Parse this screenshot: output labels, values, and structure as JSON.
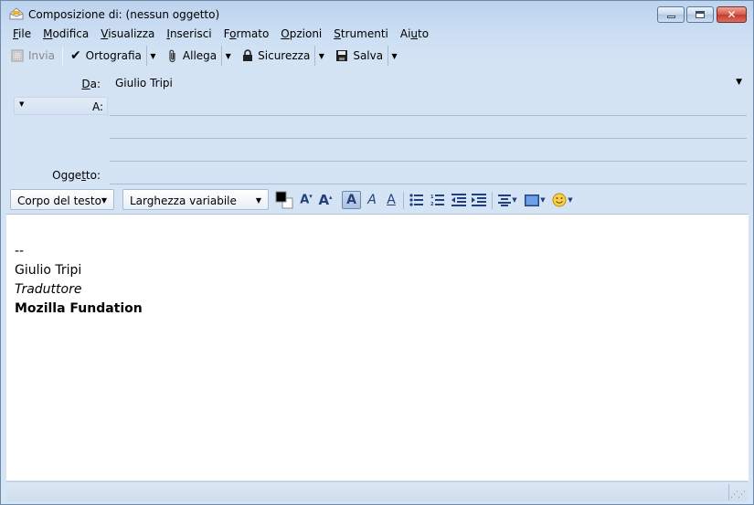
{
  "window": {
    "title": "Composizione di: (nessun oggetto)"
  },
  "menu": [
    {
      "pre": "",
      "acc": "F",
      "post": "ile"
    },
    {
      "pre": "",
      "acc": "M",
      "post": "odifica"
    },
    {
      "pre": "",
      "acc": "V",
      "post": "isualizza"
    },
    {
      "pre": "",
      "acc": "I",
      "post": "nserisci"
    },
    {
      "pre": "F",
      "acc": "o",
      "post": "rmato"
    },
    {
      "pre": "",
      "acc": "O",
      "post": "pzioni"
    },
    {
      "pre": "",
      "acc": "S",
      "post": "trumenti"
    },
    {
      "pre": "Ai",
      "acc": "u",
      "post": "to"
    }
  ],
  "toolbar": {
    "send_label": "Invia",
    "spelling_label": "Ortografia",
    "attach_label": "Allega",
    "security_label": "Sicurezza",
    "save_label": "Salva"
  },
  "header": {
    "from_label_acc": "D",
    "from_label_rest": "a:",
    "from_value": "Giulio Tripi",
    "to_label": "A:",
    "subject_label_pre": "Ogge",
    "subject_label_acc": "t",
    "subject_label_post": "to:"
  },
  "format": {
    "paragraph_style": "Corpo del testo",
    "font": "Larghezza variabile",
    "text_color": "#000000",
    "bg_color": "#ffffff"
  },
  "body": {
    "signature_dash": "--",
    "signature_name": "Giulio Tripi",
    "signature_role": "Traduttore",
    "signature_org": "Mozilla Fundation"
  }
}
